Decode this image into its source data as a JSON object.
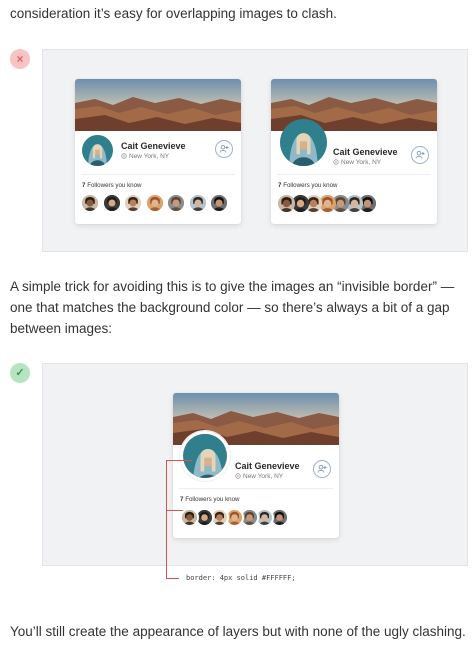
{
  "article": {
    "intro_line": "consideration it’s easy for overlapping images to clash.",
    "trick_paragraph": "A simple trick for avoiding this is to give the images an “invisible border” — one that matches the background color — so there’s always a bit of a gap between images:",
    "closing_paragraph": "You’ll still create the appearance of layers but with none of the ugly clashing."
  },
  "badges": {
    "bad_symbol": "×",
    "good_symbol": "✓",
    "bad_color": "#e35d5d",
    "good_color": "#2e9e4f"
  },
  "profile_card": {
    "name": "Cait Genevieve",
    "location": "New York, NY",
    "followers_count": "7",
    "followers_label": "Followers you know",
    "add_icon": "add-user-icon",
    "location_icon": "location-pin-icon"
  },
  "annotation": {
    "code": "border: 4px solid #FFFFFF;",
    "line_color": "#d9534f"
  },
  "followers": [
    {
      "skin": "#8a5a3c",
      "hair": "#2b1d14",
      "bg": "#c9b8a6"
    },
    {
      "skin": "#d8a982",
      "hair": "#1c1c1c",
      "bg": "#3b3b3b"
    },
    {
      "skin": "#b9805c",
      "hair": "#3a2416",
      "bg": "#e0d0c0"
    },
    {
      "skin": "#e2b38e",
      "hair": "#a0522d",
      "bg": "#d7a56b"
    },
    {
      "skin": "#c79b7a",
      "hair": "#5b4636",
      "bg": "#8c8c8c"
    },
    {
      "skin": "#d9b49a",
      "hair": "#2a2a2a",
      "bg": "#b7c3c9"
    },
    {
      "skin": "#c69276",
      "hair": "#111111",
      "bg": "#6f6f6f"
    }
  ]
}
